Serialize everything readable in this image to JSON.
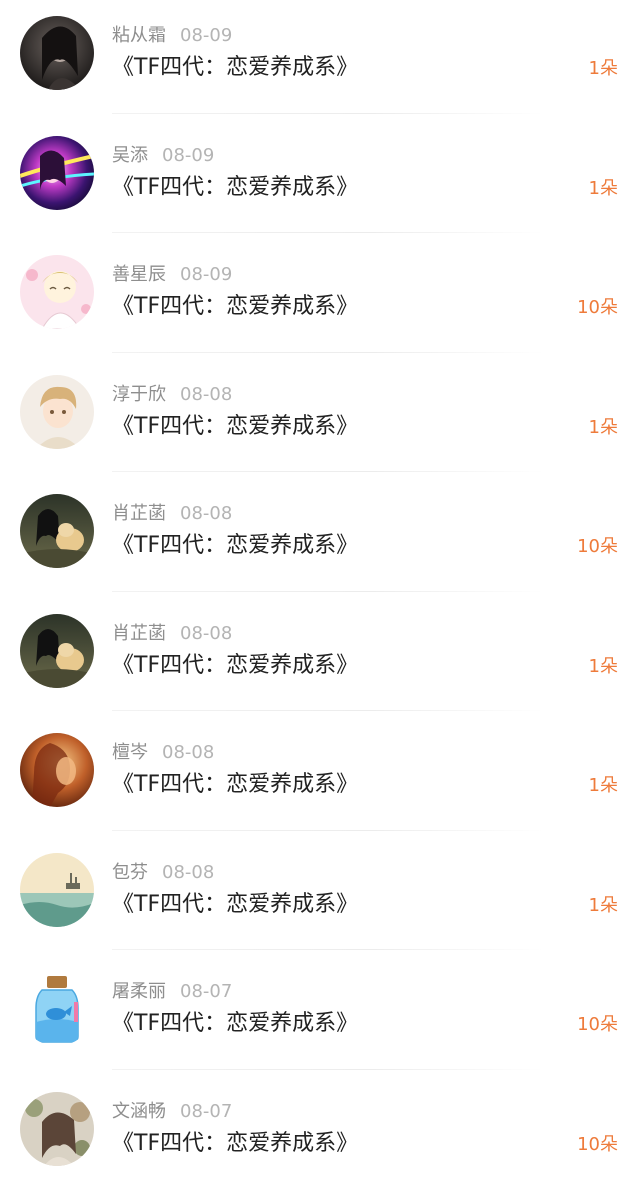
{
  "items": [
    {
      "user": "粘从霜",
      "date": "08-09",
      "title": "《TF四代：恋爱养成系》",
      "gift": "1朵",
      "avatar": "dark-portrait-avatar"
    },
    {
      "user": "吴添",
      "date": "08-09",
      "title": "《TF四代：恋爱养成系》",
      "gift": "1朵",
      "avatar": "neon-girl-avatar"
    },
    {
      "user": "善星辰",
      "date": "08-09",
      "title": "《TF四代：恋爱养成系》",
      "gift": "10朵",
      "avatar": "cartoon-girl-avatar"
    },
    {
      "user": "淳于欣",
      "date": "08-08",
      "title": "《TF四代：恋爱养成系》",
      "gift": "1朵",
      "avatar": "anime-boy-avatar"
    },
    {
      "user": "肖芷菡",
      "date": "08-08",
      "title": "《TF四代：恋爱养成系》",
      "gift": "10朵",
      "avatar": "girl-with-dog-avatar"
    },
    {
      "user": "肖芷菡",
      "date": "08-08",
      "title": "《TF四代：恋爱养成系》",
      "gift": "1朵",
      "avatar": "girl-with-dog-avatar"
    },
    {
      "user": "檀岑",
      "date": "08-08",
      "title": "《TF四代：恋爱养成系》",
      "gift": "1朵",
      "avatar": "warm-profile-avatar"
    },
    {
      "user": "包芬",
      "date": "08-08",
      "title": "《TF四代：恋爱养成系》",
      "gift": "1朵",
      "avatar": "sea-ship-avatar"
    },
    {
      "user": "屠柔丽",
      "date": "08-07",
      "title": "《TF四代：恋爱养成系》",
      "gift": "10朵",
      "avatar": "whale-bottle-avatar"
    },
    {
      "user": "文涵畅",
      "date": "08-07",
      "title": "《TF四代：恋爱养成系》",
      "gift": "10朵",
      "avatar": "flower-girl-avatar"
    }
  ],
  "colors": {
    "gift": "#ee7b3b",
    "username": "#8e8e8e",
    "date": "#b4b4b4",
    "title": "#222222"
  }
}
